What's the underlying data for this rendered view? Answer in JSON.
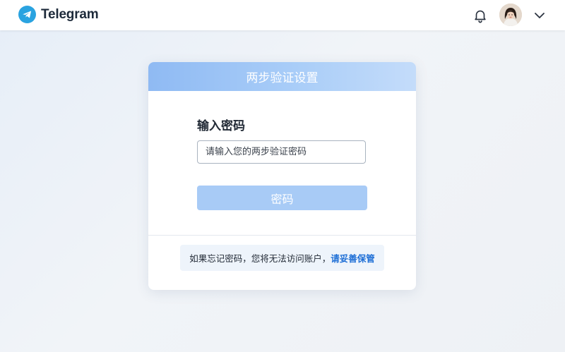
{
  "app": {
    "title": "Telegram"
  },
  "header": {
    "notifications_icon": "bell-icon",
    "menu_icon": "chevron-down-icon"
  },
  "card": {
    "title": "两步验证设置",
    "field_label": "输入密码",
    "input_value": "",
    "input_placeholder": "请输入您的两步验证密码",
    "submit_label": "密码",
    "note_text": "如果忘记密码，您将无法访问账户，",
    "note_link": "请妥善保管"
  },
  "colors": {
    "brand": "#2aa3e0",
    "header_gradient_start": "#8fbaf3",
    "button": "#a8cbf6",
    "link": "#1f6fd6"
  }
}
